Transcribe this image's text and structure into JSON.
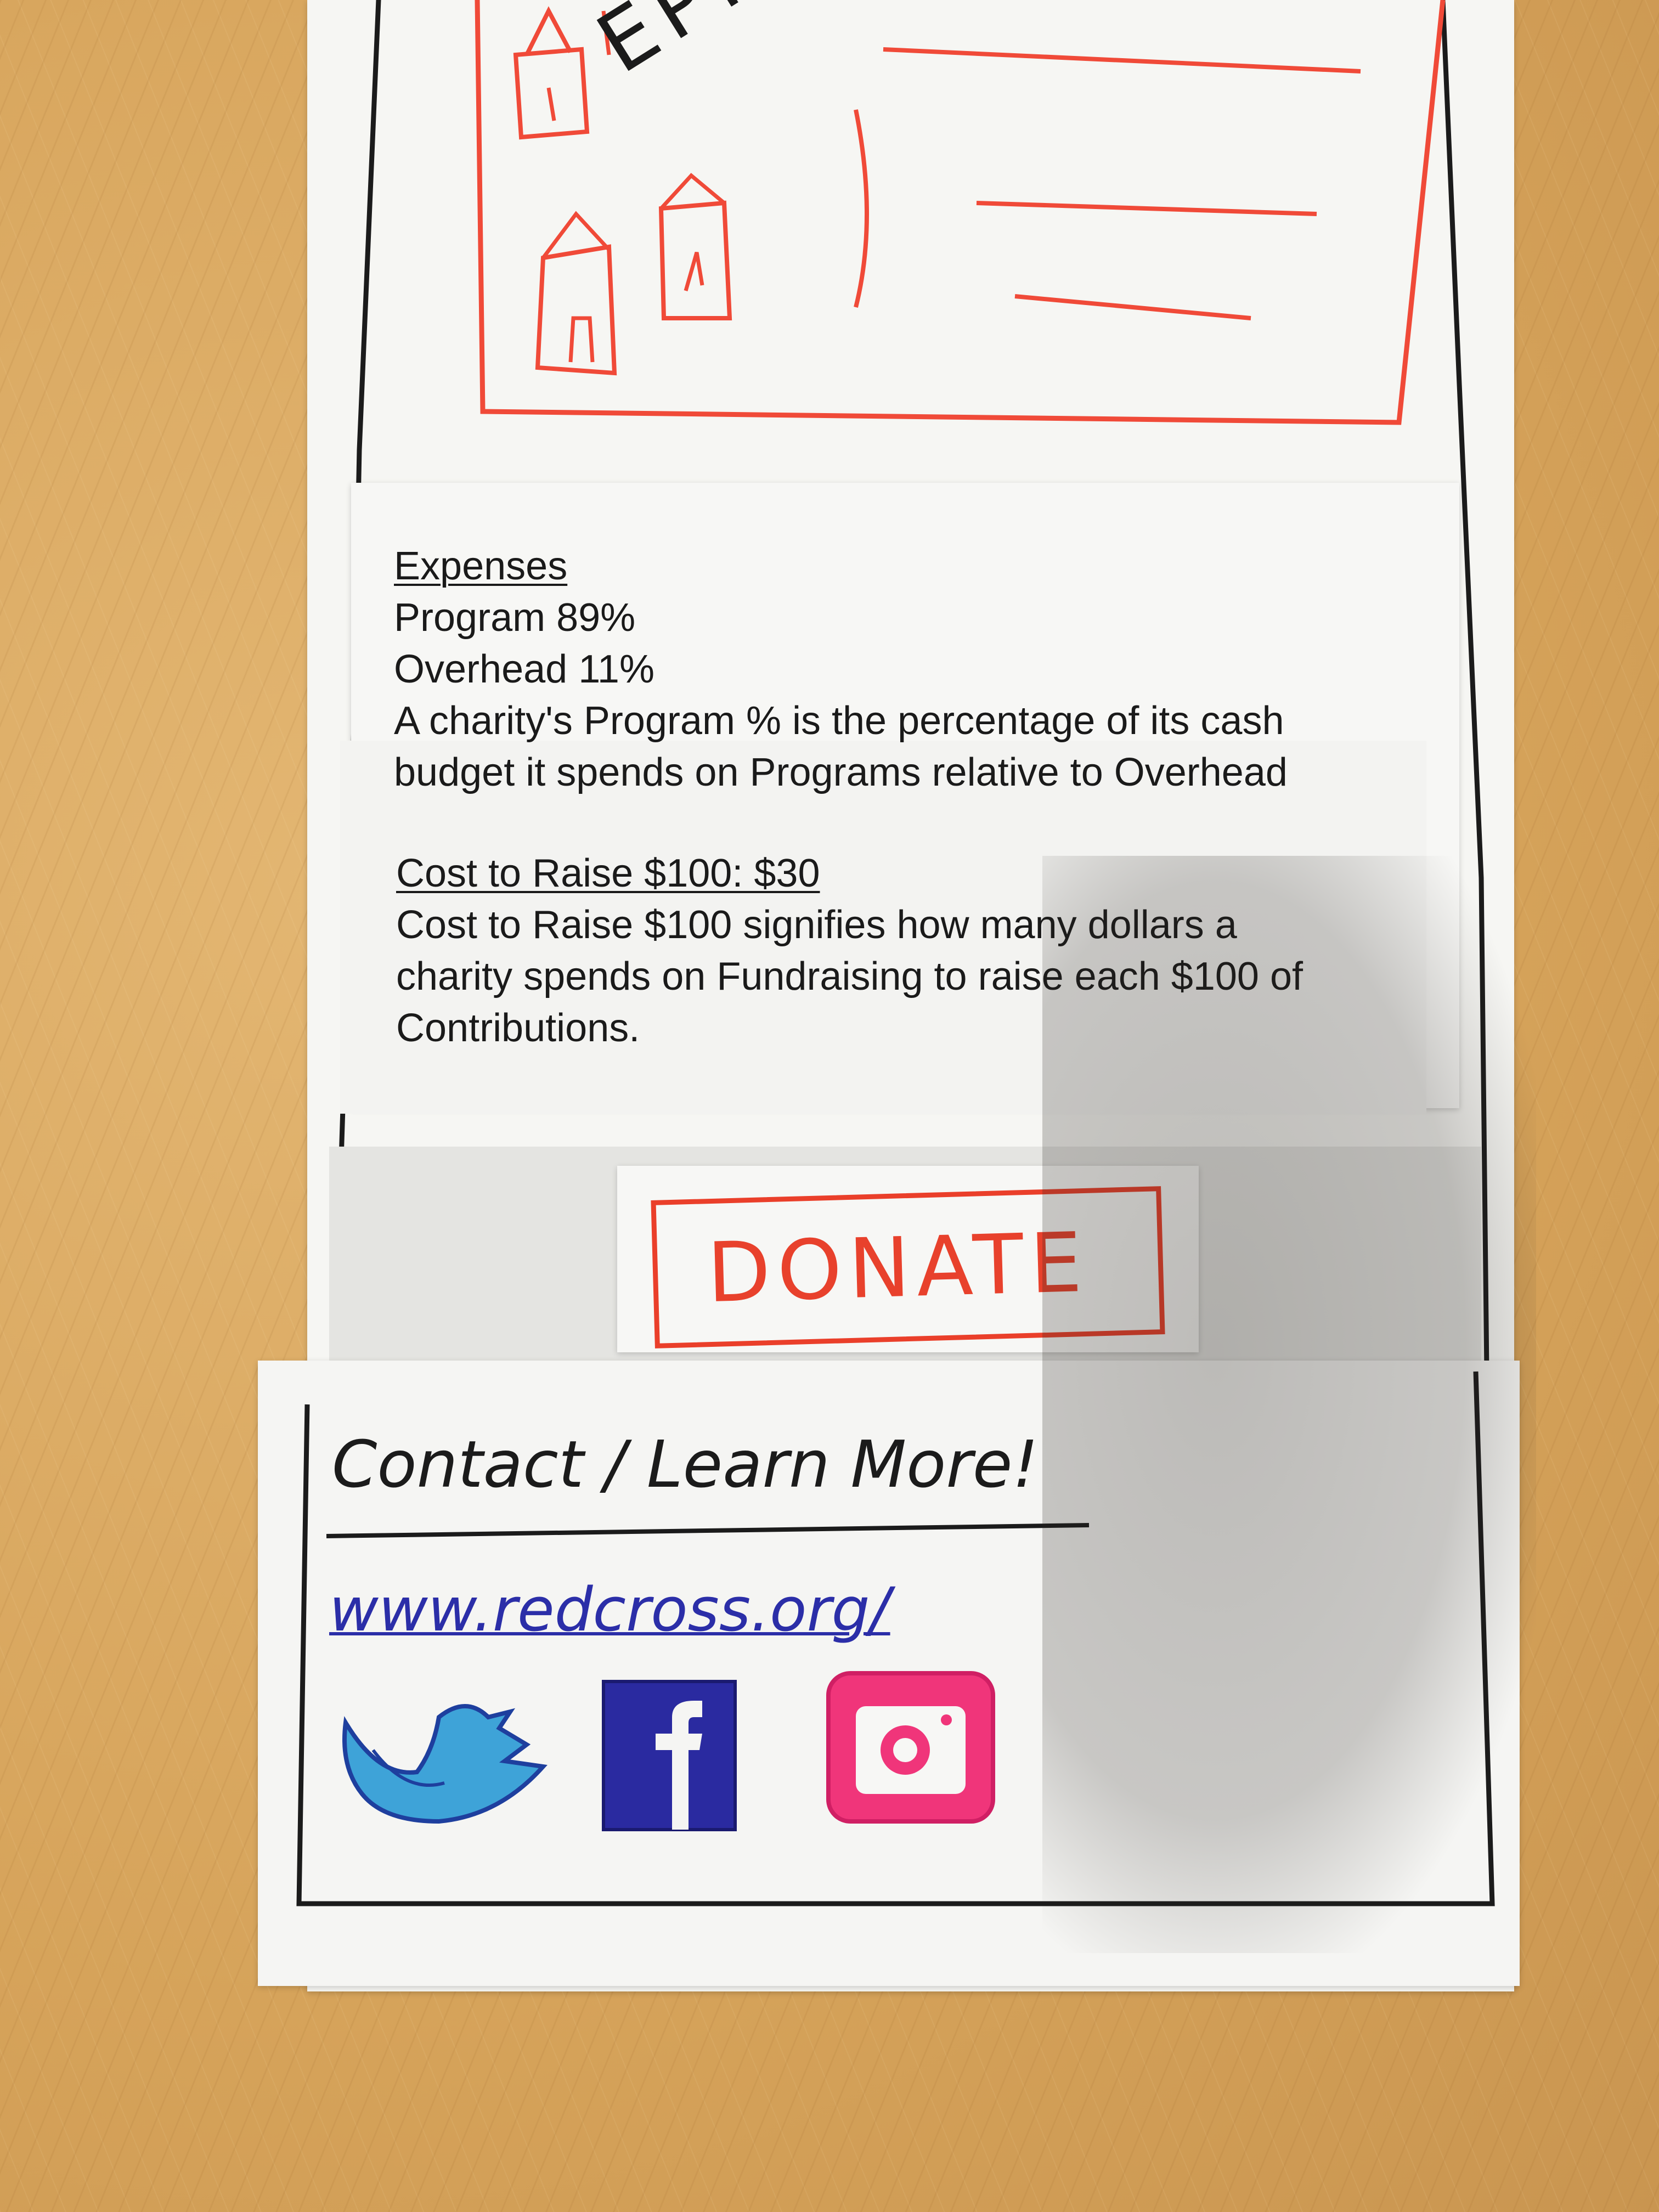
{
  "header_image": {
    "label": "EPICTU"
  },
  "expenses": {
    "heading": "Expenses",
    "program": "Program 89%",
    "overhead": "Overhead 11%",
    "desc_line1": "A charity's Program % is the percentage of its cash",
    "desc_line2": "budget it spends on Programs relative to Overhead"
  },
  "cost": {
    "heading": "Cost to Raise $100: $30",
    "line1": "Cost to Raise $100 signifies how many dollars a",
    "line2": "charity spends on Fundraising to raise each $100 of",
    "line3": "Contributions."
  },
  "donate": {
    "label": "DONATE",
    "color": "#e8412c"
  },
  "contact": {
    "heading": "Contact / Learn More!",
    "url": "www.redcross.org/"
  },
  "social": {
    "icons": [
      "twitter-icon",
      "facebook-icon",
      "instagram-icon"
    ],
    "twitter_color": "#3ea3d8",
    "facebook_color": "#2a2aa0",
    "instagram_color": "#f0357a"
  },
  "colors": {
    "marker_red": "#f04a38",
    "ink_black": "#1b1b1b",
    "link_blue": "#2b2ea8"
  }
}
